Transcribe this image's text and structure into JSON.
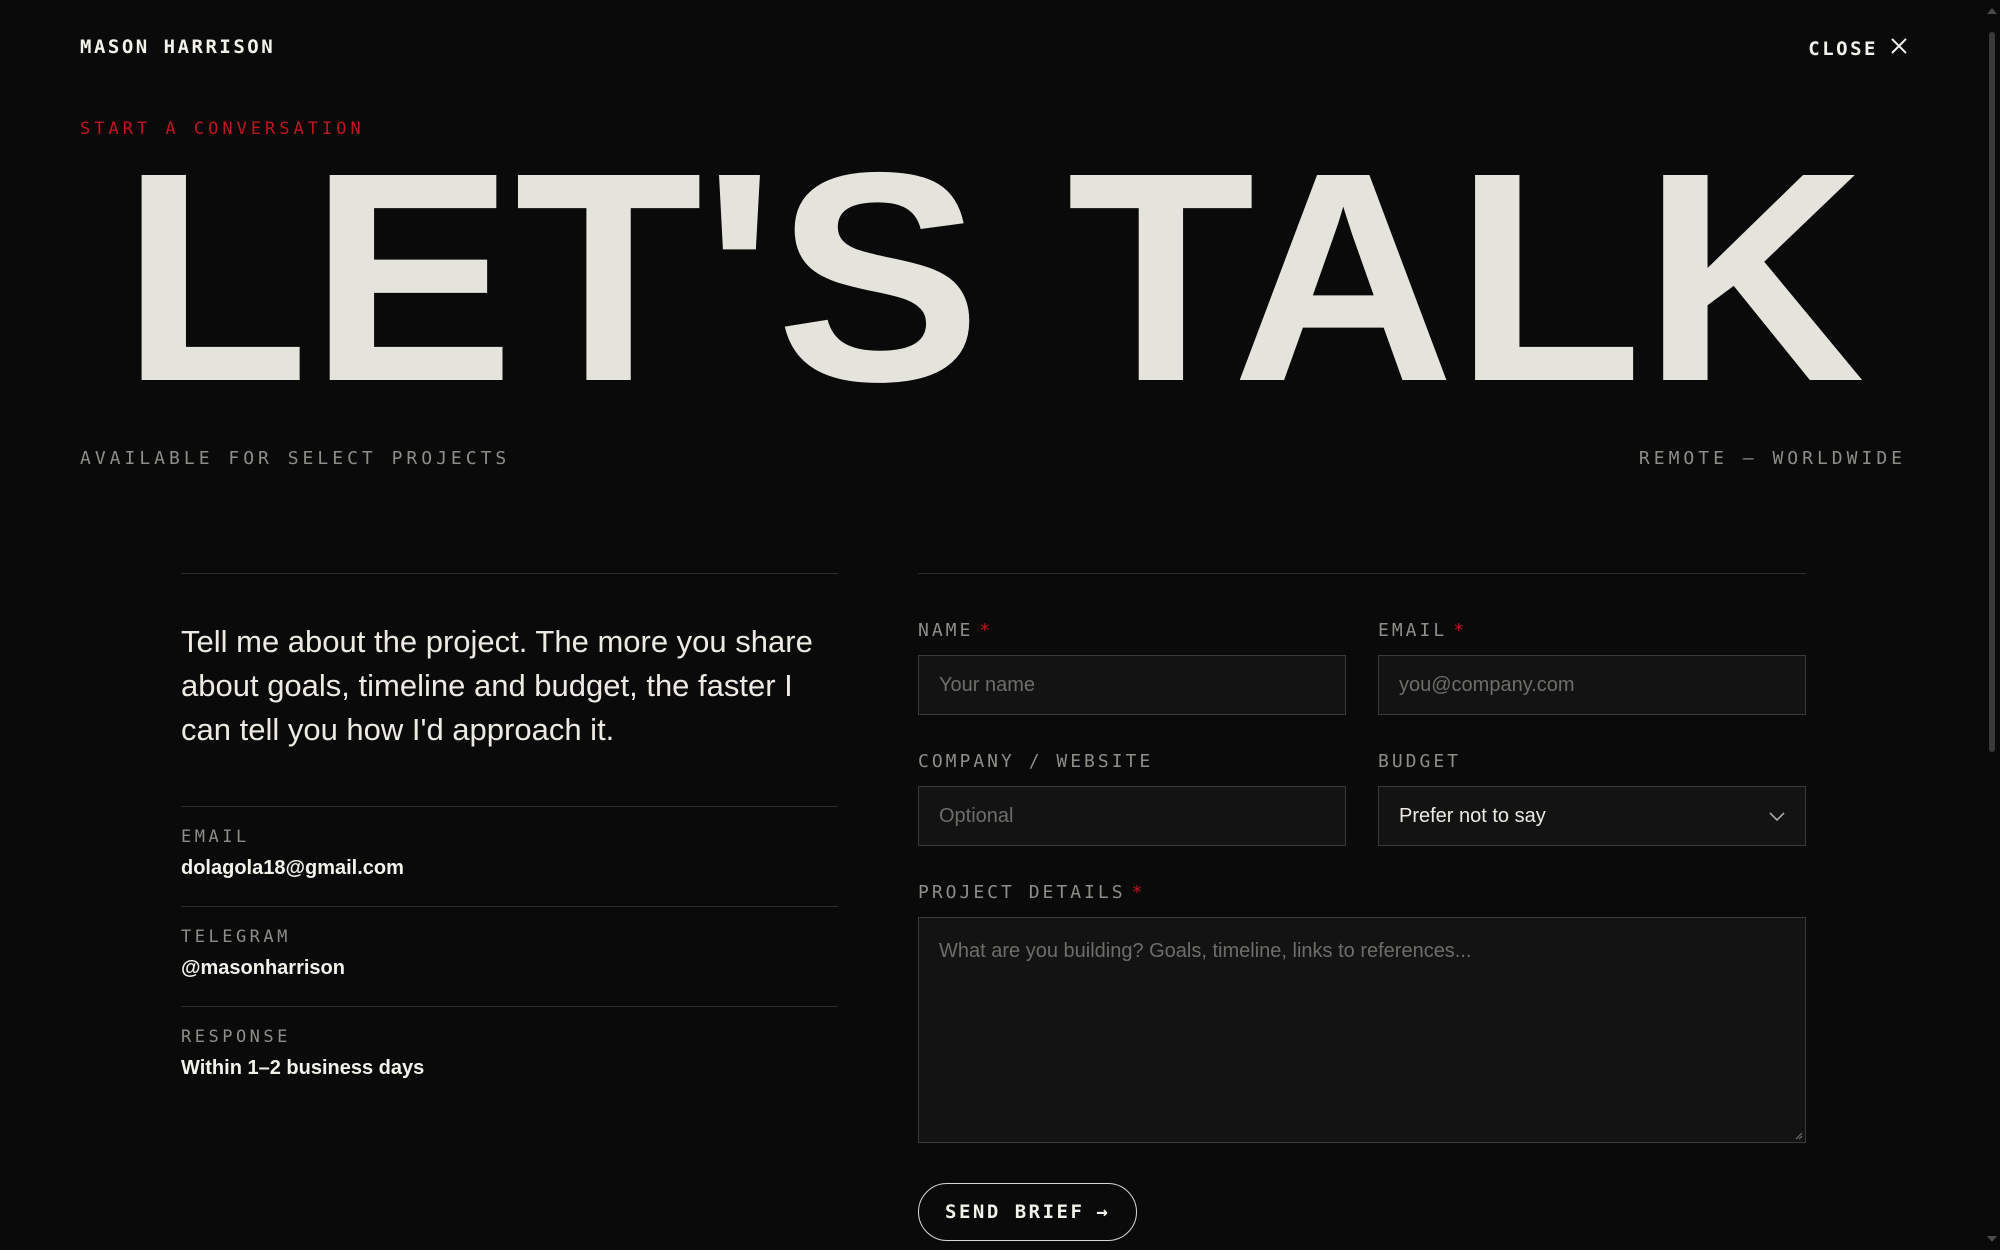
{
  "header": {
    "brand": "MASON HARRISON",
    "close_label": "CLOSE"
  },
  "hero": {
    "eyebrow": "START A CONVERSATION",
    "title": "LET'S TALK",
    "availability": "AVAILABLE FOR SELECT PROJECTS",
    "location": "REMOTE — WORLDWIDE"
  },
  "intro": {
    "text": "Tell me about the project. The more you share about goals, timeline and budget, the faster I can tell you how I'd approach it."
  },
  "contact": [
    {
      "label": "EMAIL",
      "value": "dolagola18@gmail.com"
    },
    {
      "label": "TELEGRAM",
      "value": "@masonharrison"
    },
    {
      "label": "RESPONSE",
      "value": "Within 1–2 business days"
    }
  ],
  "form": {
    "name": {
      "label": "NAME",
      "required_mark": "*",
      "placeholder": "Your name"
    },
    "email": {
      "label": "EMAIL",
      "required_mark": "*",
      "placeholder": "you@company.com"
    },
    "company": {
      "label": "COMPANY / WEBSITE",
      "placeholder": "Optional"
    },
    "budget": {
      "label": "BUDGET",
      "value": "Prefer not to say"
    },
    "details": {
      "label": "PROJECT DETAILS",
      "required_mark": "*",
      "placeholder": "What are you building? Goals, timeline, links to references..."
    },
    "submit_label": "SEND BRIEF",
    "submit_arrow": "→"
  },
  "colors": {
    "background": "#0a0a0a",
    "accent": "#c0161f",
    "text": "#e4e3dc"
  }
}
